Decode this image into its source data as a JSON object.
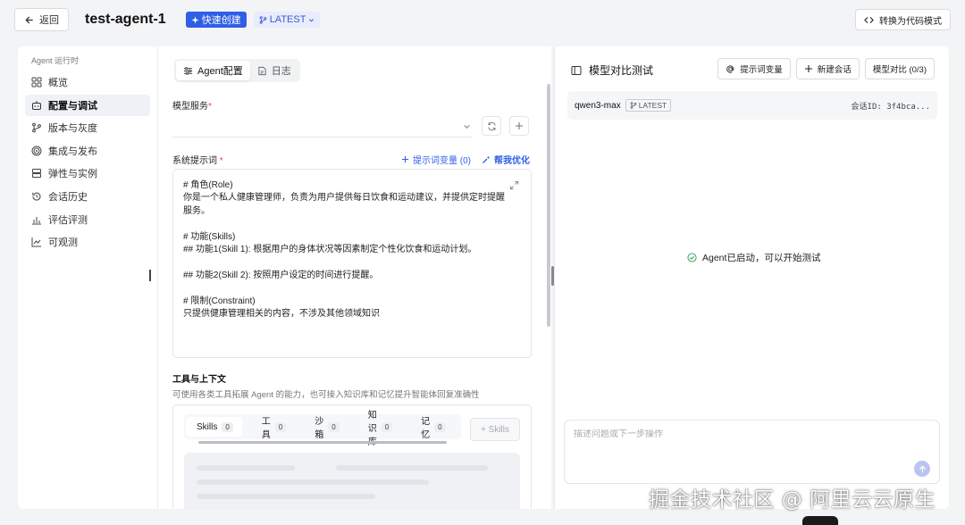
{
  "header": {
    "back_label": "返回",
    "agent_name": "test-agent-1",
    "quick_create_label": "快速创建",
    "version_label": "LATEST",
    "code_mode_label": "转换为代码模式"
  },
  "sidebar": {
    "section_title": "Agent 运行时",
    "items": [
      {
        "label": "概览",
        "icon": "grid-icon"
      },
      {
        "label": "配置与调试",
        "icon": "robot-icon",
        "active": true
      },
      {
        "label": "版本与灰度",
        "icon": "branch-icon"
      },
      {
        "label": "集成与发布",
        "icon": "target-icon"
      },
      {
        "label": "弹性与实例",
        "icon": "server-icon"
      },
      {
        "label": "会话历史",
        "icon": "history-icon"
      },
      {
        "label": "评估评测",
        "icon": "bar-chart-icon"
      },
      {
        "label": "可观测",
        "icon": "line-chart-icon"
      }
    ]
  },
  "config": {
    "tabs": [
      {
        "label": "Agent配置",
        "icon": "sliders-icon",
        "active": true
      },
      {
        "label": "日志",
        "icon": "log-icon"
      }
    ],
    "model_service_label": "模型服务",
    "system_prompt_label": "系统提示词",
    "prompt_variables_label": "提示词变量 (0)",
    "optimize_label": "帮我优化",
    "prompt_lines": [
      "# 角色(Role)",
      "你是一个私人健康管理师，负责为用户提供每日饮食和运动建议，并提供定时提醒",
      "服务。",
      "",
      "# 功能(Skills)",
      "## 功能1(Skill 1): 根据用户的身体状况等因素制定个性化饮食和运动计划。",
      "",
      "## 功能2(Skill 2): 按照用户设定的时间进行提醒。",
      "",
      "# 限制(Constraint)",
      "只提供健康管理相关的内容，不涉及其他领域知识"
    ],
    "tools_title": "工具与上下文",
    "tools_desc": "可使用各类工具拓展 Agent 的能力，也可接入知识库和记忆提升智能体回复准确性",
    "tool_tabs": [
      {
        "label": "Skills",
        "count": "0",
        "active": true
      },
      {
        "label": "工具",
        "count": "0"
      },
      {
        "label": "沙箱",
        "count": "0"
      },
      {
        "label": "知识库",
        "count": "0"
      },
      {
        "label": "记忆",
        "count": "0"
      }
    ],
    "add_skill_label": "+ Skills"
  },
  "test": {
    "title": "模型对比测试",
    "prompt_var_btn": "提示词变量",
    "new_session_btn": "新建会话",
    "compare_btn": "模型对比 (0/3)",
    "model_name": "qwen3-max",
    "model_tag": "LATEST",
    "session_id": "会话ID: 3f4bca...",
    "status_message": "Agent已启动，可以开始测试",
    "input_placeholder": "描述问题或下一步操作"
  },
  "watermark": "掘金技术社区 @ 阿里云云原生",
  "colors": {
    "accent": "#2f5fe6",
    "required": "#e5484d",
    "active_nav_bg": "#eef1f6",
    "page_bg": "#f3f4f6"
  }
}
